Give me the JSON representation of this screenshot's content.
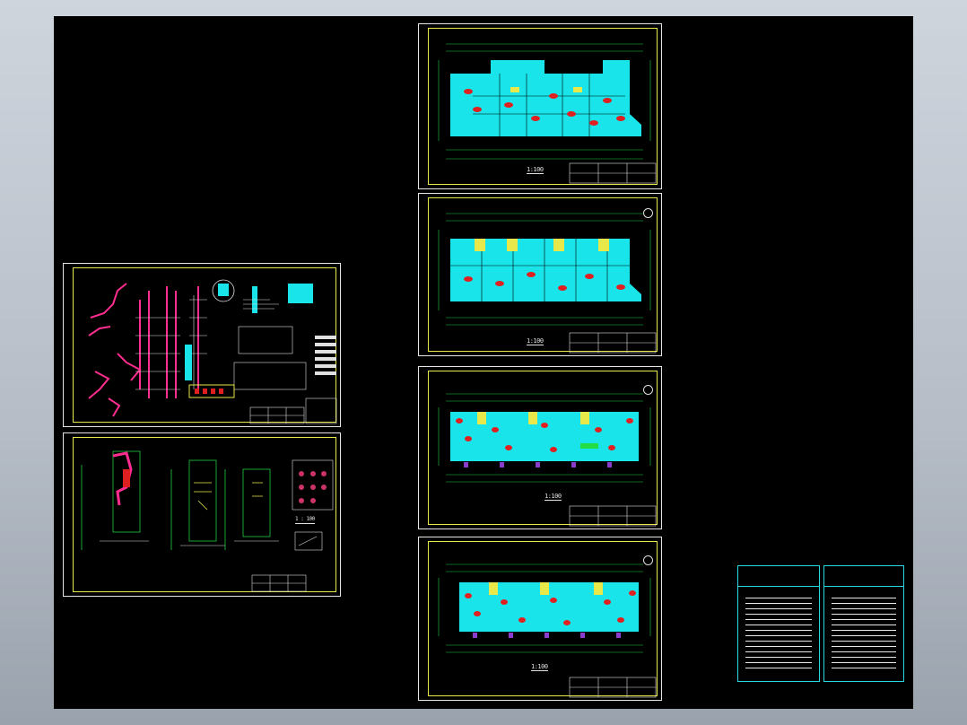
{
  "viewer": {
    "background_top": "#cfd5dd",
    "background_bottom": "#9aa2ad",
    "canvas_color": "#000000"
  },
  "colors": {
    "frame": "#e8e84a",
    "plan_fill": "#19e4ea",
    "pipe": "#ff2d8f",
    "equipment": "#e02020",
    "wall_line": "#22cc44",
    "note_frame": "#27d6df"
  },
  "sheets": {
    "plan_1": {
      "caption": "1:100"
    },
    "plan_2": {
      "caption": "1:100"
    },
    "plan_3": {
      "caption": "1:100"
    },
    "plan_4": {
      "caption": "1:100"
    },
    "stair_detail": {
      "caption": "1 : 100"
    }
  },
  "icons": [
    "north-arrow-icon",
    "grid-axis-bubble-icon"
  ]
}
